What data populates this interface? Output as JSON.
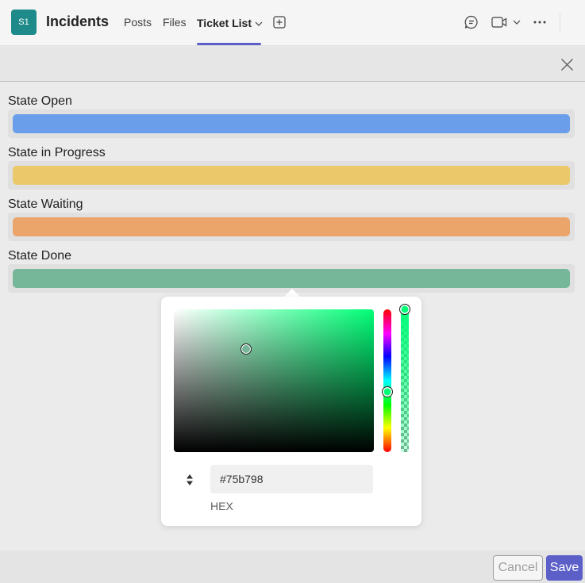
{
  "header": {
    "app_badge": "S1",
    "title": "Incidents",
    "tabs": [
      {
        "label": "Posts",
        "active": false
      },
      {
        "label": "Files",
        "active": false
      },
      {
        "label": "Ticket List",
        "active": true
      }
    ],
    "icons": [
      "add-tab-icon",
      "chat-icon",
      "video-call-icon",
      "chevron-down-icon",
      "more-options-icon"
    ]
  },
  "dialog": {
    "close_icon": "close-icon",
    "states": [
      {
        "label": "State Open",
        "color": "#6a9dea"
      },
      {
        "label": "State in Progress",
        "color": "#ebc96a"
      },
      {
        "label": "State Waiting",
        "color": "#eba46a"
      },
      {
        "label": "State Done",
        "color": "#75b798"
      }
    ]
  },
  "picker": {
    "hex_value": "#75b798",
    "format_label": "HEX",
    "hue_color": "#00ff77",
    "saturation": 0.36,
    "brightness": 0.72,
    "hue_level": 0.58,
    "alpha_level": 1.0,
    "mode_toggle_icon": "up-down-arrows-icon"
  },
  "footer": {
    "cancel_label": "Cancel",
    "save_label": "Save",
    "accent": "#5b5fc7"
  }
}
